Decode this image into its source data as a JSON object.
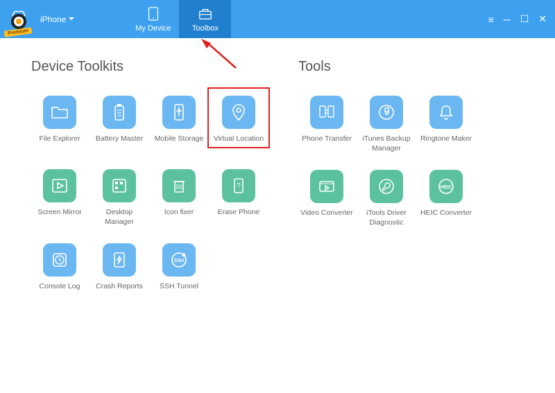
{
  "header": {
    "premium_badge": "Premium",
    "device_label": "iPhone",
    "nav": {
      "my_device": "My Device",
      "toolbox": "Toolbox"
    }
  },
  "sections": {
    "device_toolkits": {
      "title": "Device Toolkits",
      "items": {
        "file_explorer": "File Explorer",
        "battery_master": "Battery Master",
        "mobile_storage": "Mobile Storage",
        "virtual_location": "Virtual Location",
        "screen_mirror": "Screen Mirror",
        "desktop_manager": "Desktop Manager",
        "icon_fixer": "Icon fixer",
        "erase_phone": "Erase Phone",
        "console_log": "Console Log",
        "crash_reports": "Crash Reports",
        "ssh_tunnel": "SSH Tunnel"
      }
    },
    "tools": {
      "title": "Tools",
      "items": {
        "phone_transfer": "Phone Transfer",
        "itunes_backup": "iTunes Backup Manager",
        "ringtone_maker": "Ringtone Maker",
        "video_converter": "Video Converter",
        "itools_diagnostic": "iTools Driver Diagnostic",
        "heic_converter": "HEIC Converter"
      }
    }
  },
  "colors": {
    "header": "#3ea1f0",
    "header_active": "#217fd0",
    "icon_blue": "#6bb7f2",
    "icon_green": "#5bc19e",
    "highlight": "#e02020"
  }
}
